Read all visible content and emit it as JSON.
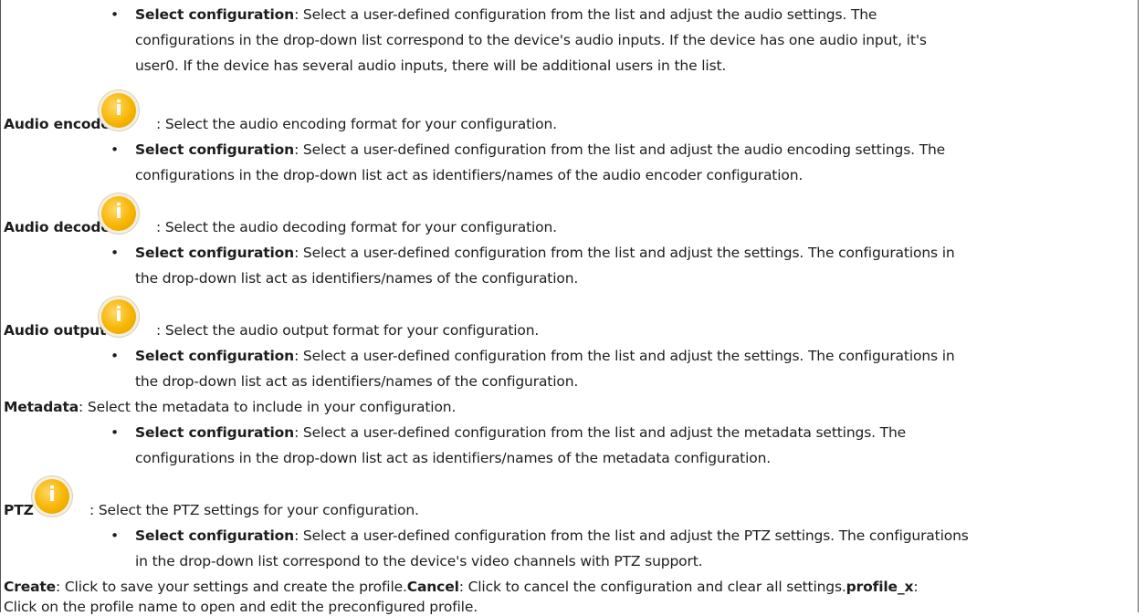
{
  "sections": {
    "audio_input_bullet": {
      "term": "Select configuration",
      "line1": ": Select a user-defined configuration from the list and adjust the audio settings. The",
      "line2": "configurations in the drop-down list correspond to the device's audio inputs. If the device has one audio input, it's",
      "line3": "user0. If the device has several audio inputs, there will be additional users in the list."
    },
    "audio_encoder": {
      "heading": "Audio encoder",
      "desc": ": Select the audio encoding format for your configuration.",
      "bullet_term": "Select configuration",
      "bullet_line1": ": Select a user-defined configuration from the list and adjust the audio encoding settings. The",
      "bullet_line2": "configurations in the drop-down list act as identifiers/names of the audio encoder configuration."
    },
    "audio_decoder": {
      "heading": "Audio decoder",
      "desc": ": Select the audio decoding format for your configuration.",
      "bullet_term": "Select configuration",
      "bullet_line1": ": Select a user-defined configuration from the list and adjust the settings. The configurations in",
      "bullet_line2": "the drop-down list act as identifiers/names of the configuration."
    },
    "audio_output": {
      "heading": "Audio output",
      "desc": ": Select the audio output format for your configuration.",
      "bullet_term": "Select configuration",
      "bullet_line1": ": Select a user-defined configuration from the list and adjust the settings. The configurations in",
      "bullet_line2": "the drop-down list act as identifiers/names of the configuration."
    },
    "metadata": {
      "heading": "Metadata",
      "desc": ": Select the metadata to include in your configuration.",
      "bullet_term": "Select configuration",
      "bullet_line1": ": Select a user-defined configuration from the list and adjust the metadata settings. The",
      "bullet_line2": "configurations in the drop-down list act as identifiers/names of the metadata configuration."
    },
    "ptz": {
      "heading": "PTZ",
      "desc": ": Select the PTZ settings for your configuration.",
      "bullet_term": "Select configuration",
      "bullet_line1": ": Select a user-defined configuration from the list and adjust the PTZ settings. The configurations",
      "bullet_line2": "in the drop-down list correspond to the device's video channels with PTZ support."
    },
    "footer": {
      "create_term": "Create",
      "create_desc": ": Click to save your settings and create the profile.",
      "cancel_term": "Cancel",
      "cancel_desc": ": Click to cancel the configuration and clear all settings.",
      "profile_term": "profile_x",
      "profile_desc_1": ":",
      "profile_desc_2": "Click on the profile name to open and edit the preconfigured profile."
    }
  },
  "icons": {
    "info_glyph": "i",
    "info_icon_name": "info-icon",
    "accent": "#f7b500"
  },
  "bullet_char": "•"
}
